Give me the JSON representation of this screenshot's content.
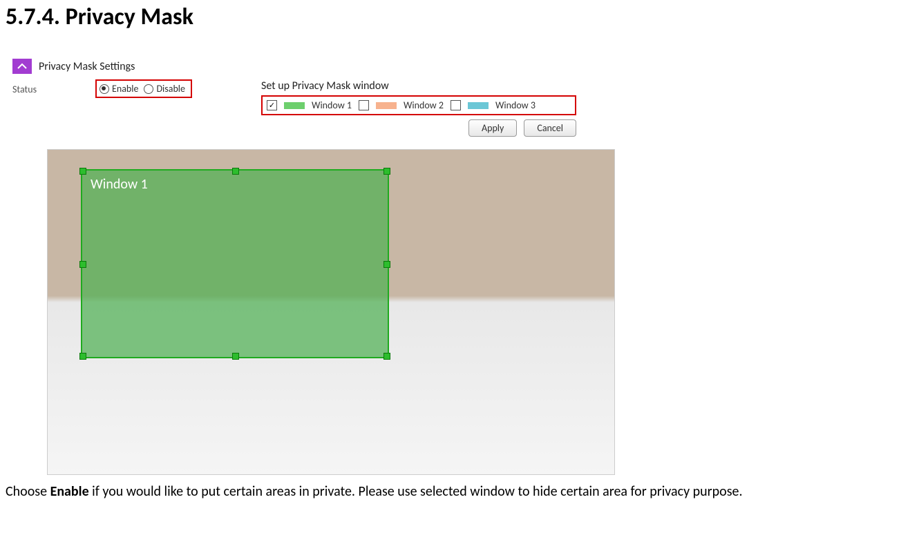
{
  "heading": "5.7.4.   Privacy Mask",
  "panel": {
    "title": "Privacy Mask Settings",
    "status_label": "Status",
    "enable_label": "Enable",
    "disable_label": "Disable",
    "status_selected": "enable",
    "setup_label": "Set up Privacy Mask window",
    "windows": [
      {
        "label": "Window 1",
        "checked": true,
        "color": "#6dcf6d"
      },
      {
        "label": "Window 2",
        "checked": false,
        "color": "#f7b28e"
      },
      {
        "label": "Window 3",
        "checked": false,
        "color": "#6bc7d6"
      }
    ],
    "apply_label": "Apply",
    "cancel_label": "Cancel",
    "mask_label": "Window 1"
  },
  "caption_prefix": "Choose ",
  "caption_bold": "Enable",
  "caption_rest": " if you would like to put certain areas in private. Please use selected window to hide certain area for privacy purpose."
}
